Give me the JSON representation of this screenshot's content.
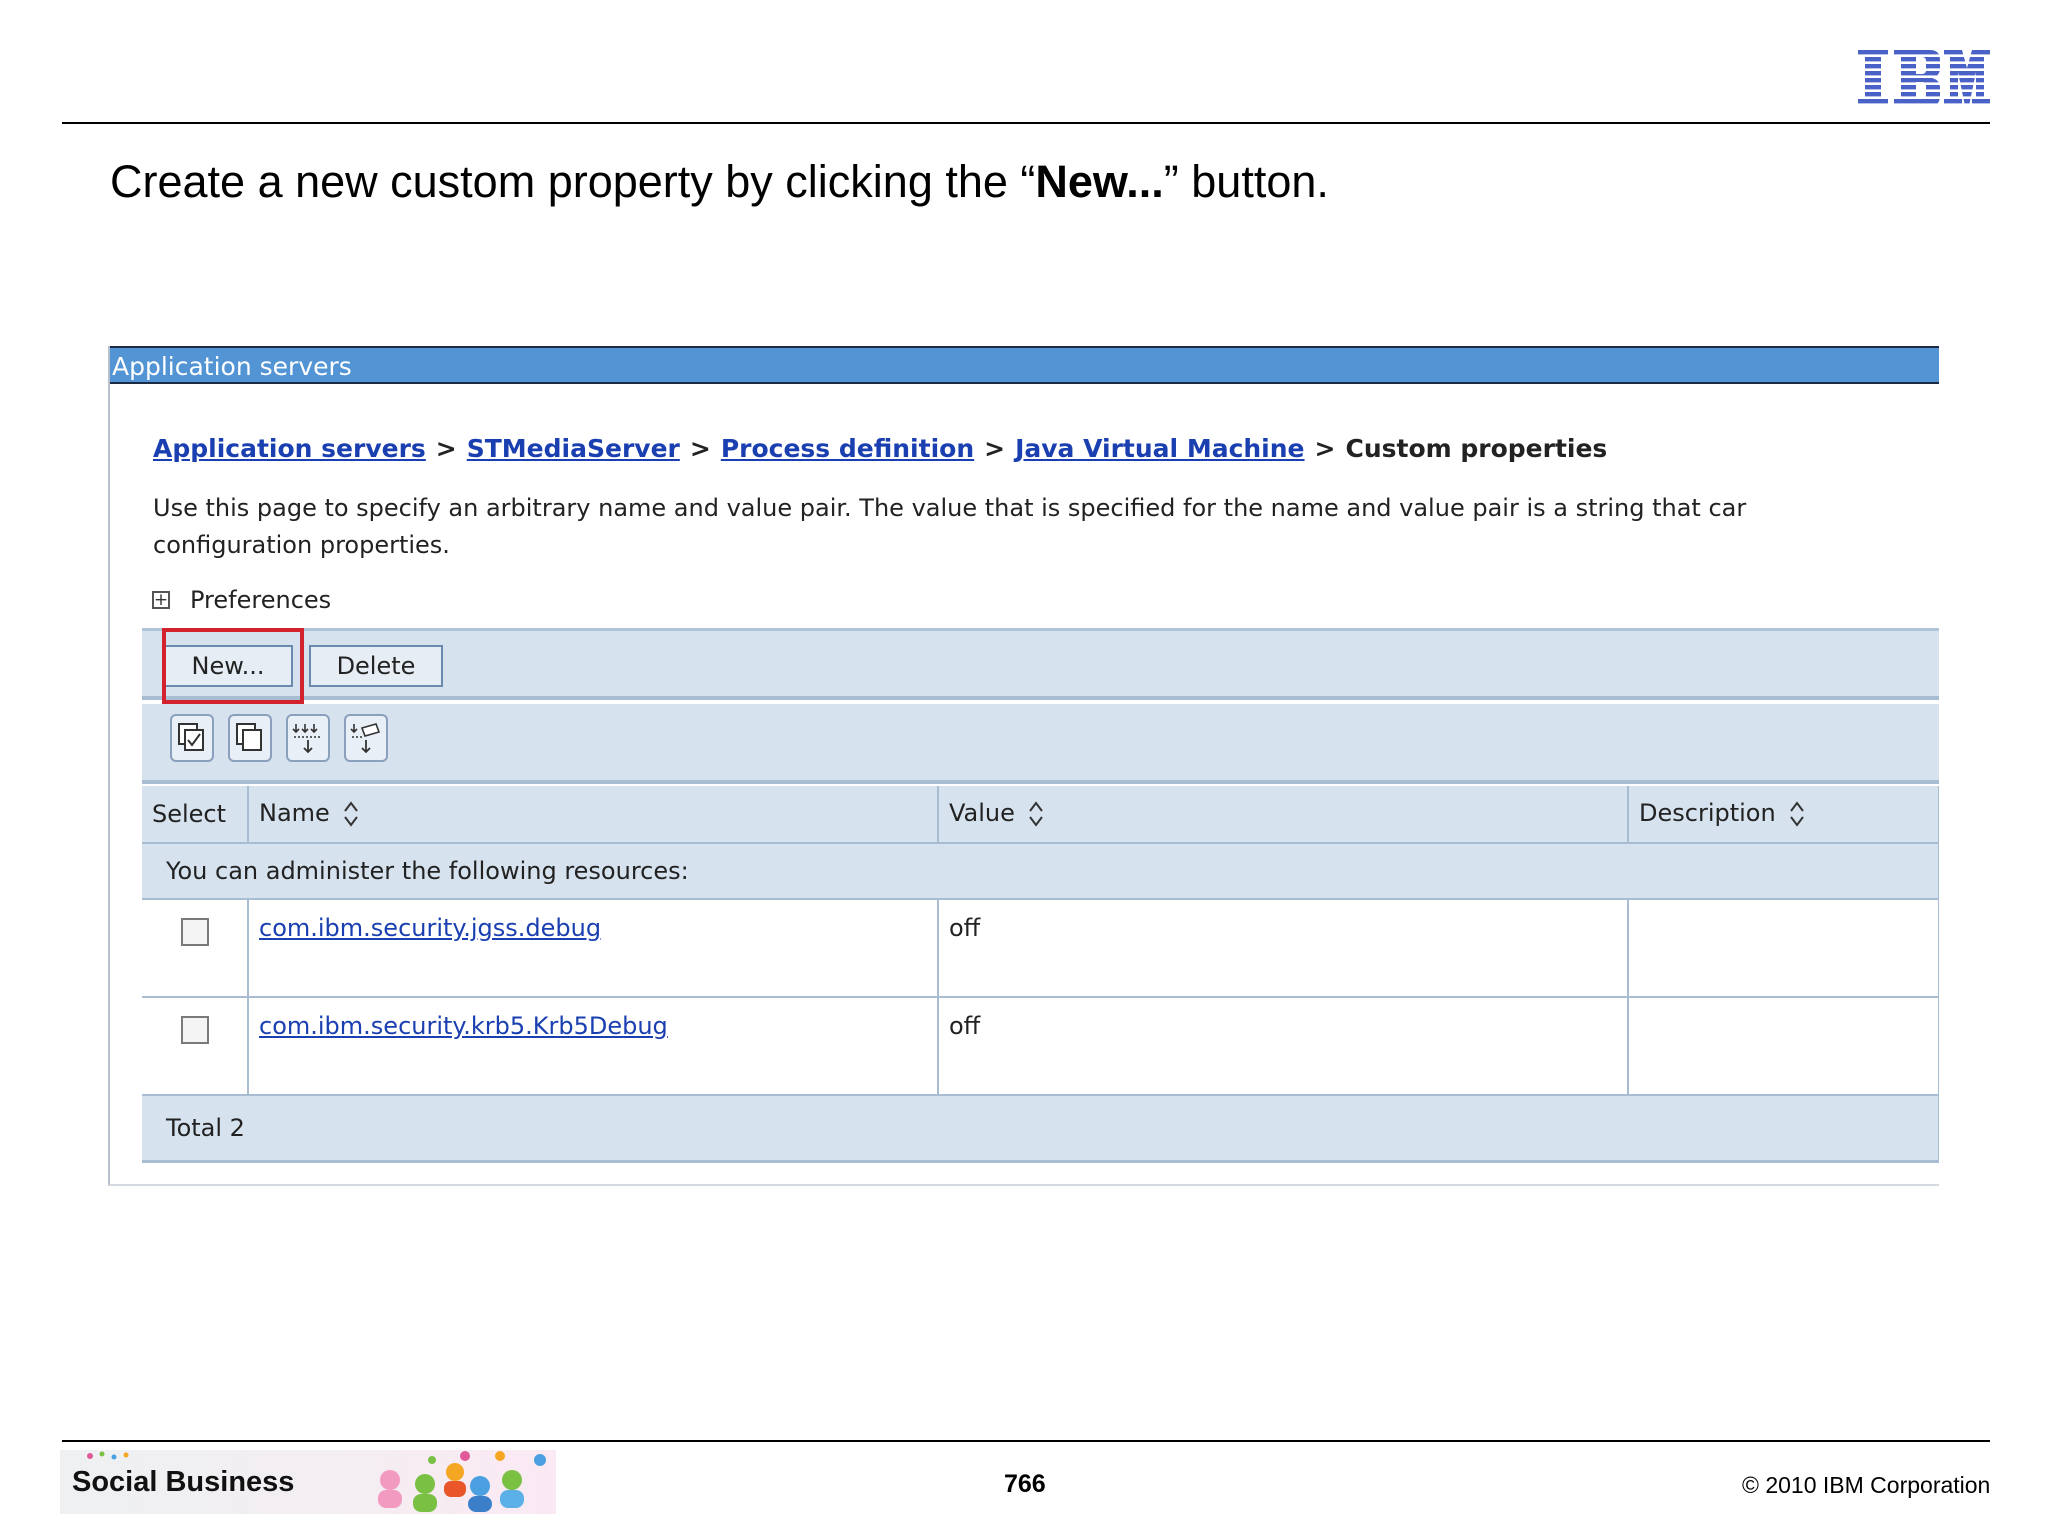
{
  "slide": {
    "title_prefix": "Create a new custom property by clicking the “",
    "title_bold": "New...",
    "title_suffix": "” button."
  },
  "panel": {
    "header": "Application servers",
    "breadcrumb": {
      "links": [
        "Application servers",
        "STMediaServer",
        "Process definition",
        "Java Virtual Machine"
      ],
      "separator": ">",
      "current": "Custom properties"
    },
    "description_line1": "Use this page to specify an arbitrary name and value pair. The value that is specified for the name and value pair is a string that car",
    "description_line2": "configuration properties.",
    "preferences_label": "Preferences",
    "buttons": {
      "new": "New...",
      "delete": "Delete"
    },
    "icon_buttons": [
      "select-all-icon",
      "deselect-all-icon",
      "show-filter-icon",
      "clear-filter-icon"
    ],
    "table": {
      "columns": [
        "Select",
        "Name",
        "Value",
        "Description"
      ],
      "resources_message": "You can administer the following resources:",
      "rows": [
        {
          "name": "com.ibm.security.jgss.debug",
          "value": "off",
          "description": ""
        },
        {
          "name": "com.ibm.security.krb5.Krb5Debug",
          "value": "off",
          "description": ""
        }
      ],
      "total": "Total 2"
    }
  },
  "footer": {
    "brand": "Social Business",
    "page_number": "766",
    "copyright": "© 2010 IBM Corporation"
  },
  "colors": {
    "header_blue": "#5294d4",
    "link_blue": "#1a3fb0",
    "toolbar_bg": "#d6e2ee",
    "highlight_red": "#d4212e",
    "ibm_blue": "#4a62c8"
  }
}
